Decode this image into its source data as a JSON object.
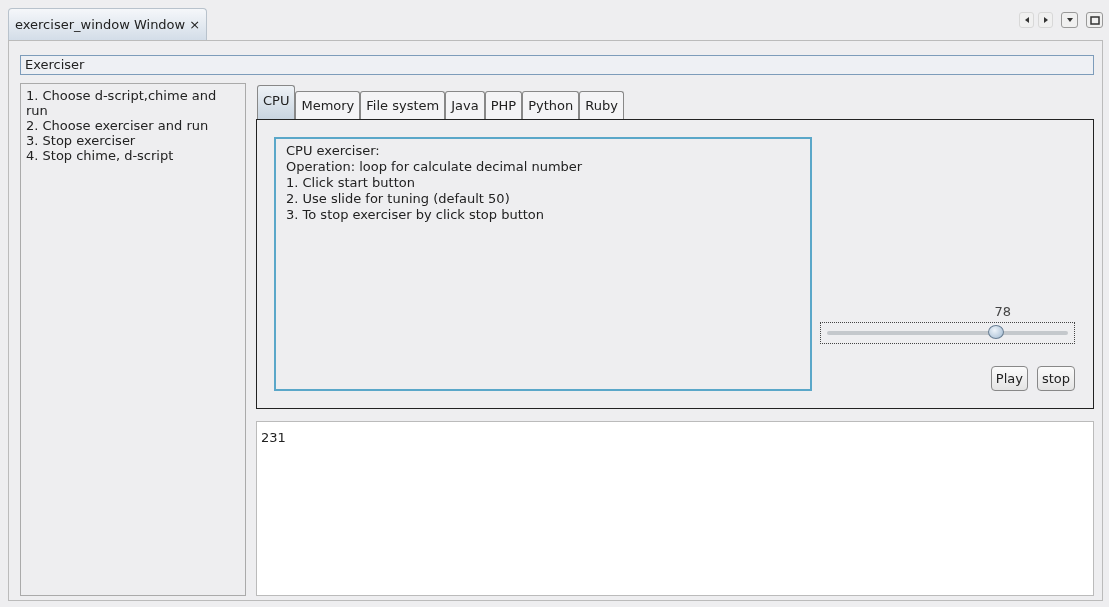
{
  "window_tab": {
    "title": "exerciser_window Window",
    "close": "×"
  },
  "header": {
    "value": "Exerciser"
  },
  "instructions": [
    "1. Choose d-script,chime and run",
    "2. Choose exerciser and run",
    "3. Stop exerciser",
    "4. Stop chime, d-script"
  ],
  "tabs": [
    {
      "label": "CPU",
      "selected": true
    },
    {
      "label": "Memory",
      "selected": false
    },
    {
      "label": "File system",
      "selected": false
    },
    {
      "label": "Java",
      "selected": false
    },
    {
      "label": "PHP",
      "selected": false
    },
    {
      "label": "Python",
      "selected": false
    },
    {
      "label": "Ruby",
      "selected": false
    }
  ],
  "description": [
    "CPU exerciser:",
    "Operation: loop for calculate decimal number",
    "1. Click start button",
    "2. Use slide for tuning (default 50)",
    "3. To stop exerciser by click stop button"
  ],
  "slider": {
    "reading": "78",
    "level": 0.7
  },
  "buttons": [
    "Play",
    "stop"
  ],
  "output": {
    "value": "231"
  }
}
